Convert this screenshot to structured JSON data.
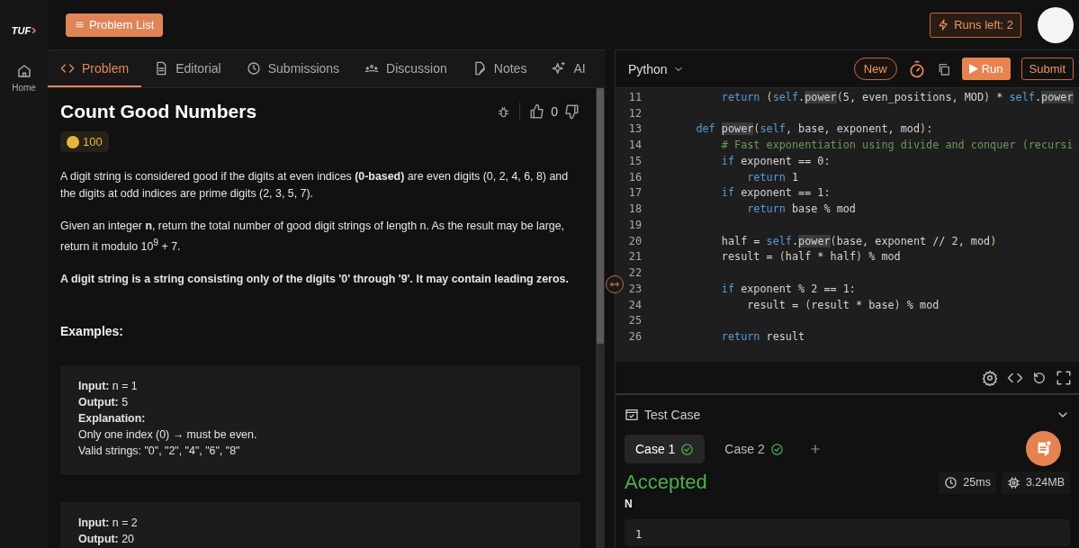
{
  "sidebar": {
    "logo": "TUF",
    "items": [
      {
        "label": "Home"
      }
    ]
  },
  "topbar": {
    "problem_list": "Problem List",
    "runs_left": "Runs left: 2"
  },
  "tabs": [
    {
      "label": "Problem",
      "selected": true
    },
    {
      "label": "Editorial",
      "selected": false
    },
    {
      "label": "Submissions",
      "selected": false
    },
    {
      "label": "Discussion",
      "selected": false
    },
    {
      "label": "Notes",
      "selected": false
    },
    {
      "label": "AI",
      "selected": false
    }
  ],
  "problem": {
    "title": "Count Good Numbers",
    "coins": "100",
    "likes": "0",
    "paragraphs": [
      {
        "kind": "normal",
        "text": "A digit string is considered good if the digits at even indices **(0-based)** are even digits (0, 2, 4, 6, 8) and the digits at odd indices are prime digits (2, 3, 5, 7)."
      },
      {
        "kind": "normal",
        "text": "Given an integer **n**, return the total number of good digit strings of length n. As the result may be large, return it modulo 10$^{9}$ + 7."
      },
      {
        "kind": "bold",
        "text": "A digit string is a string consisting only of the digits '0' through '9'. It may contain leading zeros."
      }
    ],
    "examples_heading": "Examples:",
    "examples": [
      {
        "lines": [
          "**Input:** n = 1",
          "**Output:** 5",
          "**Explanation:**",
          "Only one index (0) → must be even.",
          "Valid strings: \"0\", \"2\", \"4\", \"6\", \"8\""
        ]
      },
      {
        "lines": [
          "**Input:** n = 2",
          "**Output:** 20"
        ]
      }
    ]
  },
  "editor": {
    "language": "Python",
    "new": "New",
    "run": "Run",
    "submit": "Submit",
    "lines": [
      {
        "number": "11",
        "tokens": [
          {
            "kind": "keyword",
            "text": "        return "
          },
          {
            "kind": "paren",
            "text": "("
          },
          {
            "kind": "self",
            "text": "self"
          },
          {
            "kind": "plain",
            "text": "."
          },
          {
            "kind": "highlight",
            "text": "power"
          },
          {
            "kind": "paren",
            "text": "("
          },
          {
            "kind": "plain",
            "text": "5, even_positions, MOD"
          },
          {
            "kind": "paren",
            "text": ")"
          },
          {
            "kind": "plain",
            "text": " * "
          },
          {
            "kind": "self",
            "text": "self"
          },
          {
            "kind": "plain",
            "text": "."
          },
          {
            "kind": "highlight",
            "text": "power"
          }
        ]
      },
      {
        "number": "12"
      },
      {
        "number": "13",
        "tokens": [
          {
            "kind": "keyword",
            "text": "    def "
          },
          {
            "kind": "highlight",
            "text": "power"
          },
          {
            "kind": "paren",
            "text": "("
          },
          {
            "kind": "self",
            "text": "self"
          },
          {
            "kind": "plain",
            "text": ", base, exponent, mod"
          },
          {
            "kind": "paren",
            "text": ")"
          },
          {
            "kind": "plain",
            "text": ":"
          }
        ]
      },
      {
        "number": "14",
        "tokens": [
          {
            "kind": "comment",
            "text": "        # Fast exponentiation using divide and conquer (recursi"
          }
        ]
      },
      {
        "number": "15",
        "tokens": [
          {
            "kind": "keyword",
            "text": "        if"
          },
          {
            "kind": "plain",
            "text": " exponent == 0:"
          }
        ]
      },
      {
        "number": "16",
        "tokens": [
          {
            "kind": "keyword",
            "text": "            return"
          },
          {
            "kind": "plain",
            "text": " 1"
          }
        ]
      },
      {
        "number": "17",
        "tokens": [
          {
            "kind": "keyword",
            "text": "        if"
          },
          {
            "kind": "plain",
            "text": " exponent == 1:"
          }
        ]
      },
      {
        "number": "18",
        "tokens": [
          {
            "kind": "keyword",
            "text": "            return"
          },
          {
            "kind": "plain",
            "text": " base % mod"
          }
        ]
      },
      {
        "number": "19"
      },
      {
        "number": "20",
        "tokens": [
          {
            "kind": "plain",
            "text": "        half = "
          },
          {
            "kind": "self",
            "text": "self"
          },
          {
            "kind": "plain",
            "text": "."
          },
          {
            "kind": "highlight",
            "text": "power"
          },
          {
            "kind": "paren",
            "text": "("
          },
          {
            "kind": "plain",
            "text": "base, exponent // 2, mod"
          },
          {
            "kind": "paren",
            "text": ")"
          }
        ]
      },
      {
        "number": "21",
        "tokens": [
          {
            "kind": "plain",
            "text": "        result = "
          },
          {
            "kind": "paren",
            "text": "("
          },
          {
            "kind": "plain",
            "text": "half * half"
          },
          {
            "kind": "paren",
            "text": ")"
          },
          {
            "kind": "plain",
            "text": " % mod"
          }
        ]
      },
      {
        "number": "22"
      },
      {
        "number": "23",
        "tokens": [
          {
            "kind": "keyword",
            "text": "        if"
          },
          {
            "kind": "plain",
            "text": " exponent % 2 == 1:"
          }
        ]
      },
      {
        "number": "24",
        "tokens": [
          {
            "kind": "plain",
            "text": "            result = "
          },
          {
            "kind": "paren",
            "text": "("
          },
          {
            "kind": "plain",
            "text": "result * base"
          },
          {
            "kind": "paren",
            "text": ")"
          },
          {
            "kind": "plain",
            "text": " % mod"
          }
        ]
      },
      {
        "number": "25"
      },
      {
        "number": "26",
        "tokens": [
          {
            "kind": "keyword",
            "text": "        return"
          },
          {
            "kind": "plain",
            "text": " result"
          }
        ]
      }
    ]
  },
  "testcase": {
    "title": "Test Case",
    "cases": [
      {
        "label": "Case 1",
        "selected": true,
        "passed": true
      },
      {
        "label": "Case 2",
        "selected": false,
        "passed": true
      }
    ],
    "status": "Accepted",
    "runtime": "25ms",
    "memory": "3.24MB",
    "input_label": "N",
    "input_value": "1"
  }
}
